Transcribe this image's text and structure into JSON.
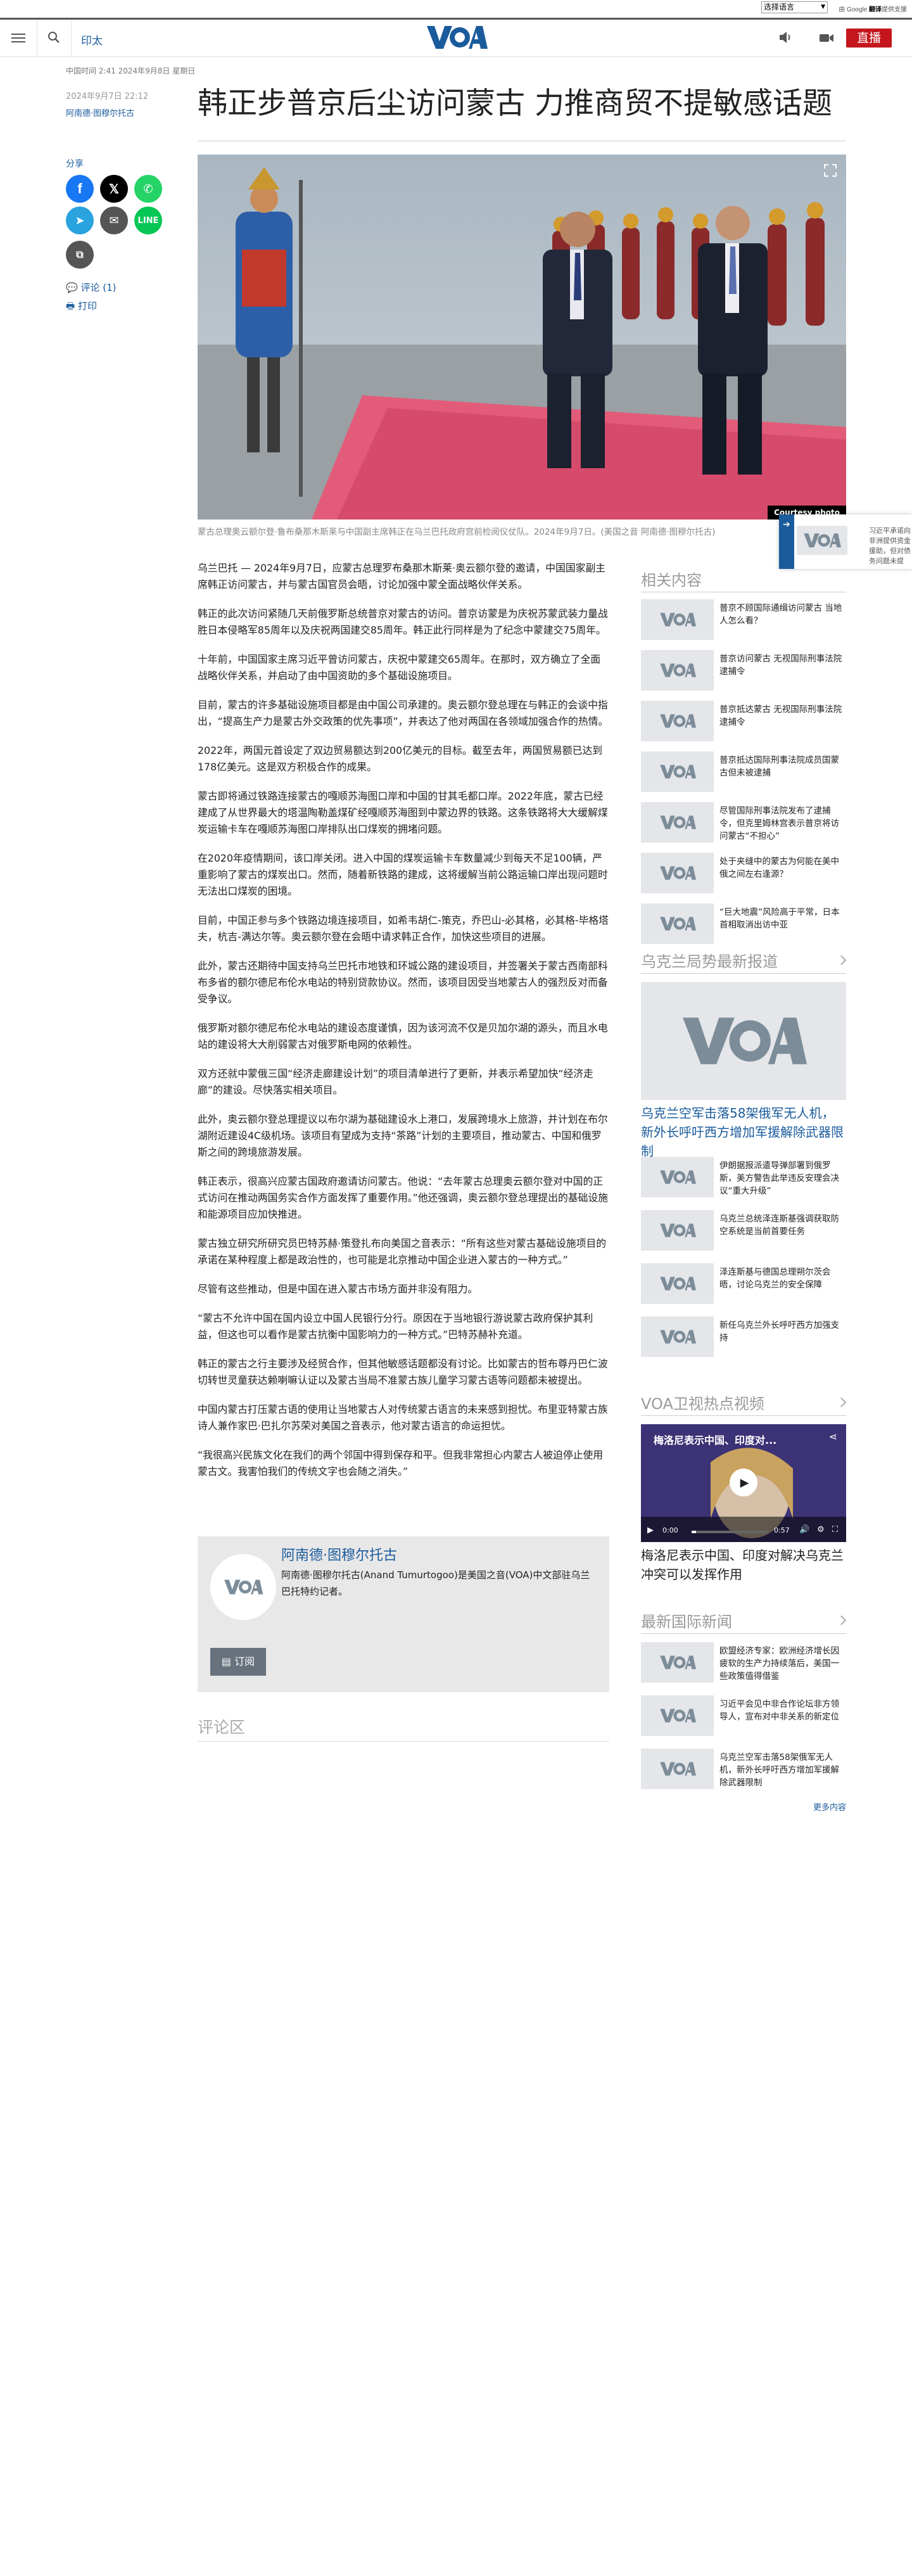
{
  "top": {
    "language_select": "选择语言",
    "powered_by": "由 Google",
    "translate": "翻译",
    "translate_suffix": "提供支援"
  },
  "header": {
    "print": "印太",
    "live": "直播"
  },
  "meta": {
    "updated": "中国时间 2:41 2024年9月8日 星期日",
    "published": "2024年9月7日 22:12",
    "author": "阿南德·图穆尔托古"
  },
  "headline": "韩正步普京后尘访问蒙古 力推商贸不提敏感话题",
  "share": {
    "label": "分享",
    "comments": "评论 (1)",
    "print": "打印"
  },
  "photo": {
    "credit": "Courtesy photo",
    "caption": "蒙古总理奥云额尔登·鲁布桑那木斯莱与中国副主席韩正在乌兰巴托政府宫前检阅仪仗队。2024年9月7日。(美国之音 阿南德·图穆尔托古)"
  },
  "body": [
    "乌兰巴托 — 2024年9月7日，应蒙古总理罗布桑那木斯莱·奥云额尔登的邀请，中国国家副主席韩正访问蒙古，并与蒙古国官员会晤，讨论加强中蒙全面战略伙伴关系。",
    "韩正的此次访问紧随几天前俄罗斯总统普京对蒙古的访问。普京访蒙是为庆祝苏蒙武装力量战胜日本侵略军85周年以及庆祝两国建交85周年。韩正此行同样是为了纪念中蒙建交75周年。",
    "十年前，中国国家主席习近平曾访问蒙古，庆祝中蒙建交65周年。在那时，双方确立了全面战略伙伴关系，并启动了由中国资助的多个基础设施项目。",
    "目前，蒙古的许多基础设施项目都是由中国公司承建的。奥云额尔登总理在与韩正的会谈中指出，“提高生产力是蒙古外交政策的优先事项”，并表达了他对两国在各领域加强合作的热情。",
    "2022年，两国元首设定了双边贸易额达到200亿美元的目标。截至去年，两国贸易额已达到178亿美元。这是双方积极合作的成果。",
    "蒙古即将通过铁路连接蒙古的嘎顺苏海图口岸和中国的甘其毛都口岸。2022年底，蒙古已经建成了从世界最大的塔温陶勒盖煤矿经嘎顺苏海图到中蒙边界的铁路。这条铁路将大大缓解煤炭运输卡车在嘎顺苏海图口岸排队出口煤炭的拥堵问题。",
    "在2020年疫情期间，该口岸关闭。进入中国的煤炭运输卡车数量减少到每天不足100辆，严重影响了蒙古的煤炭出口。然而，随着新铁路的建成，这将缓解当前公路运输口岸出现问题时无法出口煤炭的困境。",
    "目前，中国正参与多个铁路边境连接项目，如希韦胡仁-策克，乔巴山-必其格，必其格-毕格塔夫，杭吉-满达尔等。奥云额尔登在会晤中请求韩正合作，加快这些项目的进展。",
    "此外，蒙古还期待中国支持乌兰巴托市地铁和环城公路的建设项目，并签署关于蒙古西南部科布多省的额尔德尼布伦水电站的特别贷款协议。然而，该项目因受当地蒙古人的强烈反对而备受争议。",
    "俄罗斯对额尔德尼布伦水电站的建设态度谨慎，因为该河流不仅是贝加尔湖的源头，而且水电站的建设将大大削弱蒙古对俄罗斯电网的依赖性。",
    "双方还就中蒙俄三国“经济走廊建设计划”的项目清单进行了更新，并表示希望加快“经济走廊”的建设。尽快落实相关项目。",
    "此外，奥云额尔登总理提议以布尔湖为基础建设水上港口，发展跨境水上旅游，并计划在布尔湖附近建设4C级机场。该项目有望成为支持“茶路”计划的主要项目，推动蒙古、中国和俄罗斯之间的跨境旅游发展。",
    "韩正表示，很高兴应蒙古国政府邀请访问蒙古。他说：“去年蒙古总理奥云额尔登对中国的正式访问在推动两国务实合作方面发挥了重要作用。”他还强调，奥云额尔登总理提出的基础设施和能源项目应加快推进。",
    "蒙古独立研究所研究员巴特苏赫·策登扎布向美国之音表示：“所有这些对蒙古基础设施项目的承诺在某种程度上都是政治性的，也可能是北京推动中国企业进入蒙古的一种方式。”",
    "尽管有这些推动，但是中国在进入蒙古市场方面并非没有阻力。",
    "“蒙古不允许中国在国内设立中国人民银行分行。原因在于当地银行游说蒙古政府保护其利益，但这也可以看作是蒙古抗衡中国影响力的一种方式。”巴特苏赫补充道。",
    "韩正的蒙古之行主要涉及经贸合作，但其他敏感话题都没有讨论。比如蒙古的哲布尊丹巴仁波切转世灵童获达赖喇嘛认证以及蒙古当局不准蒙古族儿童学习蒙古语等问题都未被提出。",
    "中国内蒙古打压蒙古语的使用让当地蒙古人对传统蒙古语言的未来感到担忧。布里亚特蒙古族诗人兼作家巴·巴扎尔苏荣对美国之音表示，他对蒙古语言的命运担忧。",
    "“我很高兴民族文化在我们的两个邻国中得到保存和平。但我非常担心内蒙古人被迫停止使用蒙古文。我害怕我们的传统文字也会随之消失。”"
  ],
  "author_box": {
    "name": "阿南德·图穆尔托古",
    "desc": "阿南德·图穆尔托古(Anand Tumurtogoo)是美国之音(VOA)中文部驻乌兰巴托特约记者。",
    "subscribe": "订阅"
  },
  "comments_heading": "评论区",
  "related": {
    "title": "相关内容",
    "items": [
      "普京不顾国际通缉访问蒙古 当地人怎么看？",
      "普京访问蒙古 无视国际刑事法院逮捕令",
      "普京抵达蒙古 无视国际刑事法院逮捕令",
      "普京抵达国际刑事法院成员国蒙古但未被逮捕",
      "尽管国际刑事法院发布了逮捕令，但克里姆林宫表示普京将访问蒙古“不担心”",
      "处于夹缝中的蒙古为何能在美中俄之间左右逢源？",
      "“巨大地震”风险高于平常，日本首相取消出访中亚"
    ]
  },
  "ukraine": {
    "title": "乌克兰局势最新报道",
    "lead": "乌克兰空军击落58架俄军无人机，新外长呼吁西方增加军援解除武器限制",
    "items": [
      "伊朗据报派遣导弹部署到俄罗斯，美方警告此举违反安理会决议“重大升级”",
      "乌克兰总统泽连斯基强调获取防空系统是当前首要任务",
      "泽连斯基与德国总理朔尔茨会晤，讨论乌克兰的安全保障",
      "新任乌克兰外长呼吁西方加强支持"
    ]
  },
  "video": {
    "title": "VOA卫视热点视频",
    "overlay": "梅洛尼表示中国、印度对...",
    "time_cur": "0:00",
    "time_total": "0:57",
    "caption": "梅洛尼表示中国、印度对解决乌克兰冲突可以发挥作用"
  },
  "intl": {
    "title": "最新国际新闻",
    "items": [
      "欧盟经济专家：欧洲经济增长因疲软的生产力持续落后，美国一些政策值得借鉴",
      "习近平会见中非合作论坛非方领导人，宣布对中非关系的新定位",
      "乌克兰空军击落58架俄军无人机，新外长呼吁西方增加军援解除武器限制"
    ],
    "more": "更多内容"
  },
  "float_box": {
    "text": "习近平承诺向非洲提供资金援助，但对债务问题未提"
  },
  "colors": {
    "brand_blue": "#1a5b9c",
    "live_red": "#c5161d",
    "facebook": "#1877f2",
    "x": "#000000",
    "whatsapp": "#25d366",
    "telegram": "#2aa3df",
    "email": "#555555",
    "line": "#06c755"
  }
}
